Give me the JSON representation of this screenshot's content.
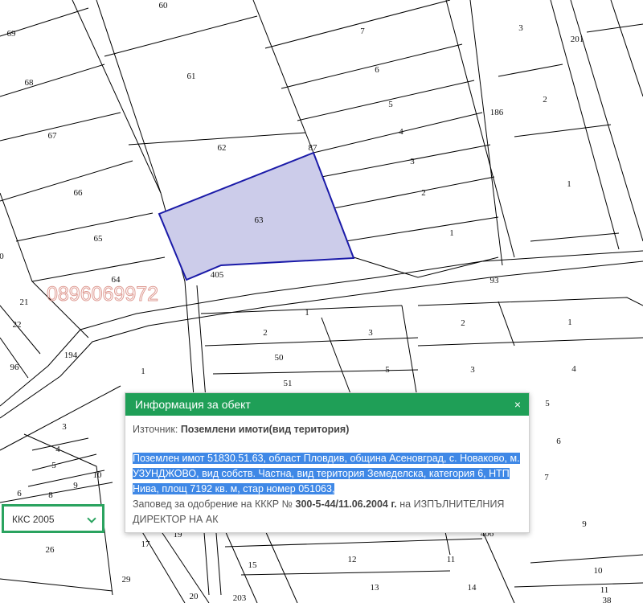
{
  "map": {
    "watermark": "0896069972",
    "parcel_labels": [
      {
        "text": "60"
      },
      {
        "text": "69"
      },
      {
        "text": "68"
      },
      {
        "text": "67"
      },
      {
        "text": "66"
      },
      {
        "text": "65"
      },
      {
        "text": "64"
      },
      {
        "text": "61"
      },
      {
        "text": "62"
      },
      {
        "text": "63"
      },
      {
        "text": "87"
      },
      {
        "text": "7"
      },
      {
        "text": "6"
      },
      {
        "text": "5"
      },
      {
        "text": "4"
      },
      {
        "text": "3"
      },
      {
        "text": "2"
      },
      {
        "text": "1"
      },
      {
        "text": "3"
      },
      {
        "text": "201"
      },
      {
        "text": "2"
      },
      {
        "text": "186"
      },
      {
        "text": "1"
      },
      {
        "text": "405"
      },
      {
        "text": "93"
      },
      {
        "text": "0"
      },
      {
        "text": "21"
      },
      {
        "text": "22"
      },
      {
        "text": "96"
      },
      {
        "text": "194"
      },
      {
        "text": "1"
      },
      {
        "text": "2"
      },
      {
        "text": "3"
      },
      {
        "text": "2"
      },
      {
        "text": "1"
      },
      {
        "text": "50"
      },
      {
        "text": "51"
      },
      {
        "text": "5"
      },
      {
        "text": "3"
      },
      {
        "text": "4"
      },
      {
        "text": "1"
      },
      {
        "text": "5"
      },
      {
        "text": "6"
      },
      {
        "text": "7"
      },
      {
        "text": "9"
      },
      {
        "text": "3"
      },
      {
        "text": "4"
      },
      {
        "text": "5"
      },
      {
        "text": "6"
      },
      {
        "text": "8"
      },
      {
        "text": "9"
      },
      {
        "text": "10"
      },
      {
        "text": "26"
      },
      {
        "text": "19"
      },
      {
        "text": "17"
      },
      {
        "text": "15"
      },
      {
        "text": "12"
      },
      {
        "text": "11"
      },
      {
        "text": "10"
      },
      {
        "text": "13"
      },
      {
        "text": "14"
      },
      {
        "text": "11"
      },
      {
        "text": "29"
      },
      {
        "text": "20"
      },
      {
        "text": "203"
      },
      {
        "text": "406"
      },
      {
        "text": "38"
      }
    ],
    "highlight_color": "#ccccea",
    "highlight_border": "#1a1aa8"
  },
  "popup": {
    "title": "Информация за обект",
    "close": "×",
    "source_label": "Източник:",
    "source_value": "Поземлени имоти(вид територия)",
    "selected_description": "Поземлен имот 51830.51.63, област Пловдив, община Асеновград, с. Новаково, м. УЗУНДЖОВО, вид собств. Частна, вид територия Земеделска, категория 6, НТП Нива, площ 7192 кв. м, стар номер 051063,",
    "order_prefix": "Заповед за одобрение на КККР №",
    "order_number": "300-5-44/11.06.2004 г.",
    "order_suffix": "на ИЗПЪЛНИТЕЛНИЯ ДИРЕКТОР НА АК",
    "header_color": "#1f9f57"
  },
  "layer_select": {
    "value": "ККС 2005"
  }
}
